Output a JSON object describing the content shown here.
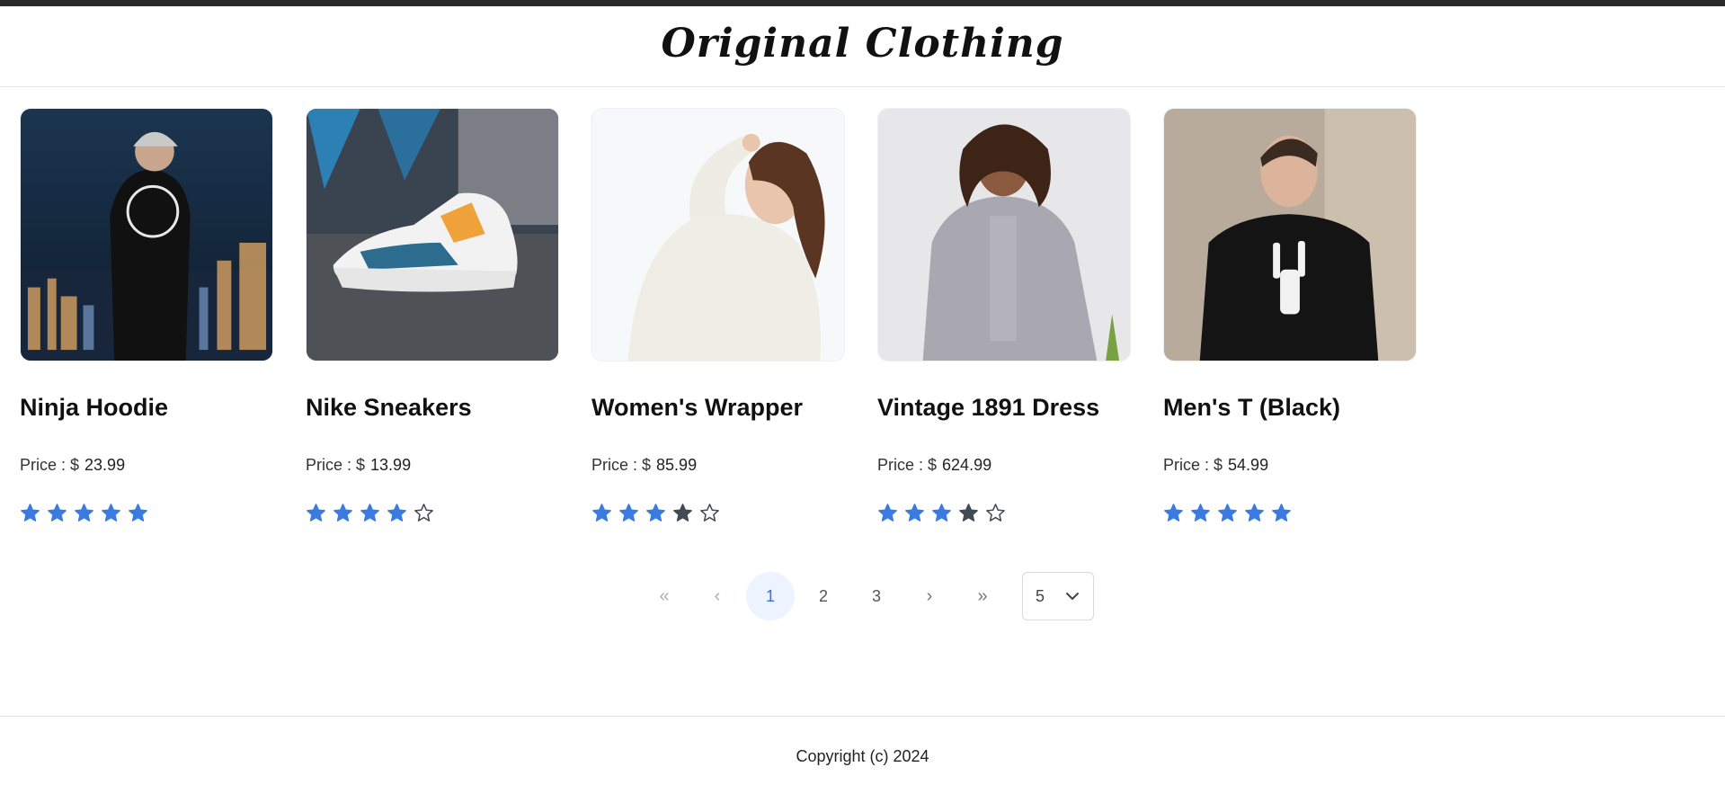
{
  "header": {
    "brand": "Original Clothing"
  },
  "products": [
    {
      "name": "Ninja Hoodie",
      "price_label": "Price : $",
      "price": "23.99",
      "rating": 5,
      "image": "ninja-hoodie-photo"
    },
    {
      "name": "Nike Sneakers",
      "price_label": "Price : $",
      "price": "13.99",
      "rating": 4,
      "image": "nike-sneakers-photo"
    },
    {
      "name": "Women's Wrapper",
      "price_label": "Price : $",
      "price": "85.99",
      "rating": 3.5,
      "image": "womens-wrapper-photo"
    },
    {
      "name": "Vintage 1891 Dress",
      "price_label": "Price : $",
      "price": "624.99",
      "rating": 3.5,
      "image": "vintage-dress-photo"
    },
    {
      "name": "Men's T (Black)",
      "price_label": "Price : $",
      "price": "54.99",
      "rating": 5,
      "image": "mens-tshirt-photo"
    }
  ],
  "pagination": {
    "first_icon": "«",
    "prev_icon": "‹",
    "pages": [
      "1",
      "2",
      "3"
    ],
    "current_page": "1",
    "next_icon": "›",
    "last_icon": "»",
    "rows_per_page": "5"
  },
  "colors": {
    "star_filled": "#3b7be0",
    "star_half": "#434a54",
    "star_empty_stroke": "#444a55",
    "active_page_bg": "#eef4ff"
  },
  "footer": {
    "copyright": "Copyright (c) 2024"
  }
}
